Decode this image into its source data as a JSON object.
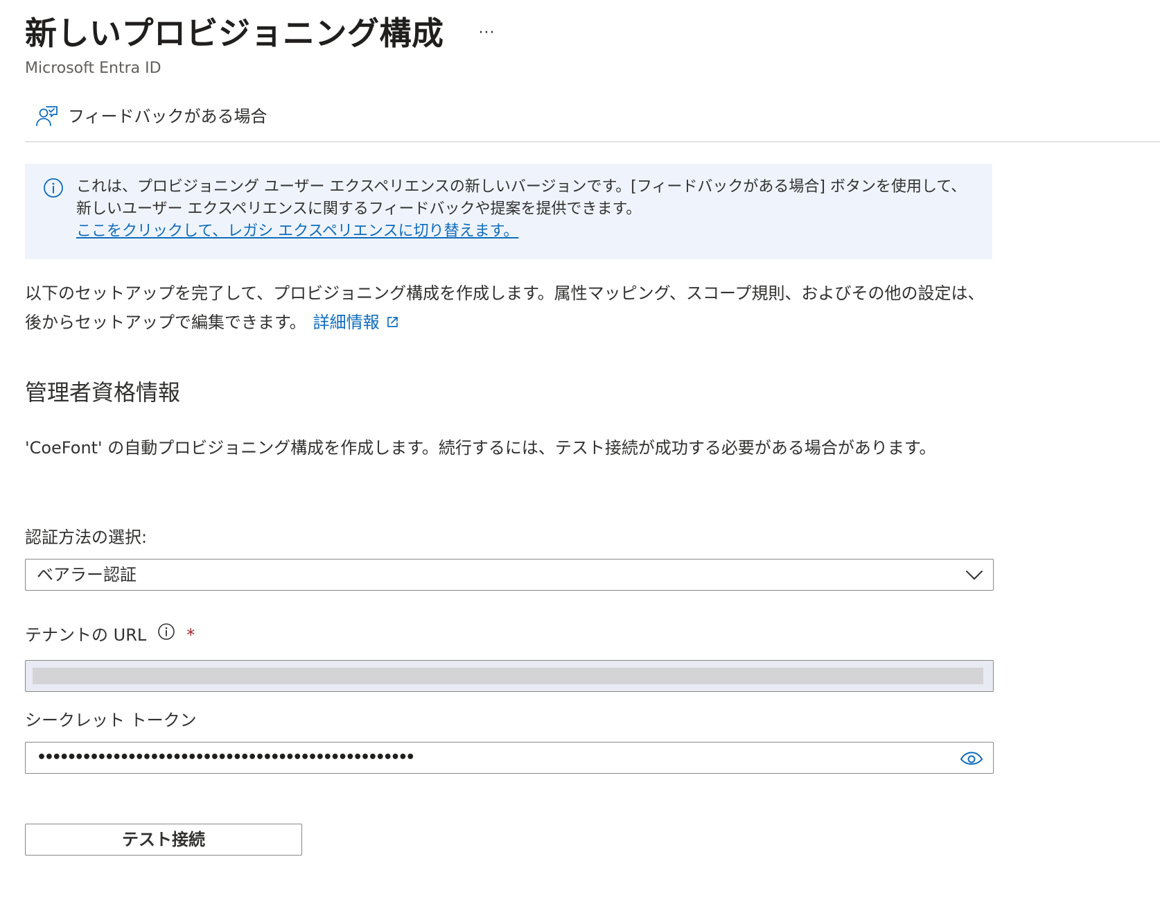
{
  "header": {
    "title": "新しいプロビジョニング構成",
    "more_label": "···",
    "subtitle": "Microsoft Entra ID"
  },
  "toolbar": {
    "feedback_label": "フィードバックがある場合",
    "feedback_icon": "feedback-person-icon"
  },
  "banner": {
    "icon": "info-icon",
    "text": "これは、プロビジョニング ユーザー エクスペリエンスの新しいバージョンです。[フィードバックがある場合] ボタンを使用して、新しいユーザー エクスペリエンスに関するフィードバックや提案を提供できます。",
    "link_text": "ここをクリックして、レガシ エクスペリエンスに切り替えます。"
  },
  "intro": {
    "text": "以下のセットアップを完了して、プロビジョニング構成を作成します。属性マッピング、スコープ規則、およびその他の設定は、後からセットアップで編集できます。",
    "learn_more": "詳細情報",
    "learn_more_icon": "external-link-icon"
  },
  "admin_credentials": {
    "heading": "管理者資格情報",
    "description": "'CoeFont' の自動プロビジョニング構成を作成します。続行するには、テスト接続が成功する必要がある場合があります。",
    "auth_method": {
      "label": "認証方法の選択:",
      "selected": "ベアラー認証",
      "icon": "chevron-down-icon"
    },
    "tenant_url": {
      "label": "テナントの URL",
      "required_mark": "*",
      "info_icon": "info-icon",
      "value": ""
    },
    "secret_token": {
      "label": "シークレット トークン",
      "value": "••••••••••••••••••••••••••••••••••••••••••••••••••",
      "reveal_icon": "eye-icon"
    },
    "test_button_label": "テスト接続"
  },
  "colors": {
    "link": "#0f6cbd",
    "banner_background": "#eff4fc",
    "required": "#a4262c",
    "text": "#323130"
  }
}
